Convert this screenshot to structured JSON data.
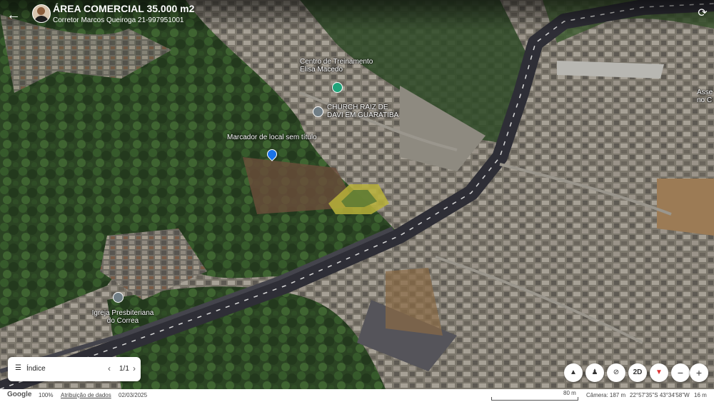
{
  "header": {
    "title": "ÁREA COMERCIAL 35.000 m2",
    "subtitle": "Corretor Marcos Queiroga 21-997951001"
  },
  "map_labels": {
    "training_center": "Centro de Treinamento Elisa Macedo",
    "church": "CHURCH RAIZ DE DAVI EM GUARATIBA",
    "placemark": "Marcador de local sem título",
    "presbyterian": "Igreja Presbiteriana do Correa",
    "right_edge": "Asse no C"
  },
  "icons": {
    "back": "arrow-left-icon",
    "refresh": "refresh-icon",
    "list": "list-icon",
    "compass": "compass-icon",
    "pegman": "person-icon",
    "tilt": "tilt-icon",
    "zoom_in": "plus-icon",
    "zoom_out": "minus-icon"
  },
  "index_panel": {
    "label": "Índice",
    "count": "1/1"
  },
  "controls": {
    "view_mode": "2D",
    "zoom_out": "−",
    "zoom_in": "+"
  },
  "status_bar": {
    "logo": "Google",
    "zoom": "100%",
    "attribution": "Atribuição de dados",
    "date": "02/03/2025",
    "scale": "80 m",
    "camera": "Câmera: 187 m",
    "coordinates": "22°57'35\"S 43°34'58\"W",
    "elevation": "16 m"
  },
  "colors": {
    "vegetation": "#2c4a24",
    "road": "#3b3b44",
    "urban": "#8a8578",
    "poi_green": "#1fa37a",
    "pin_blue": "#1a73e8"
  }
}
